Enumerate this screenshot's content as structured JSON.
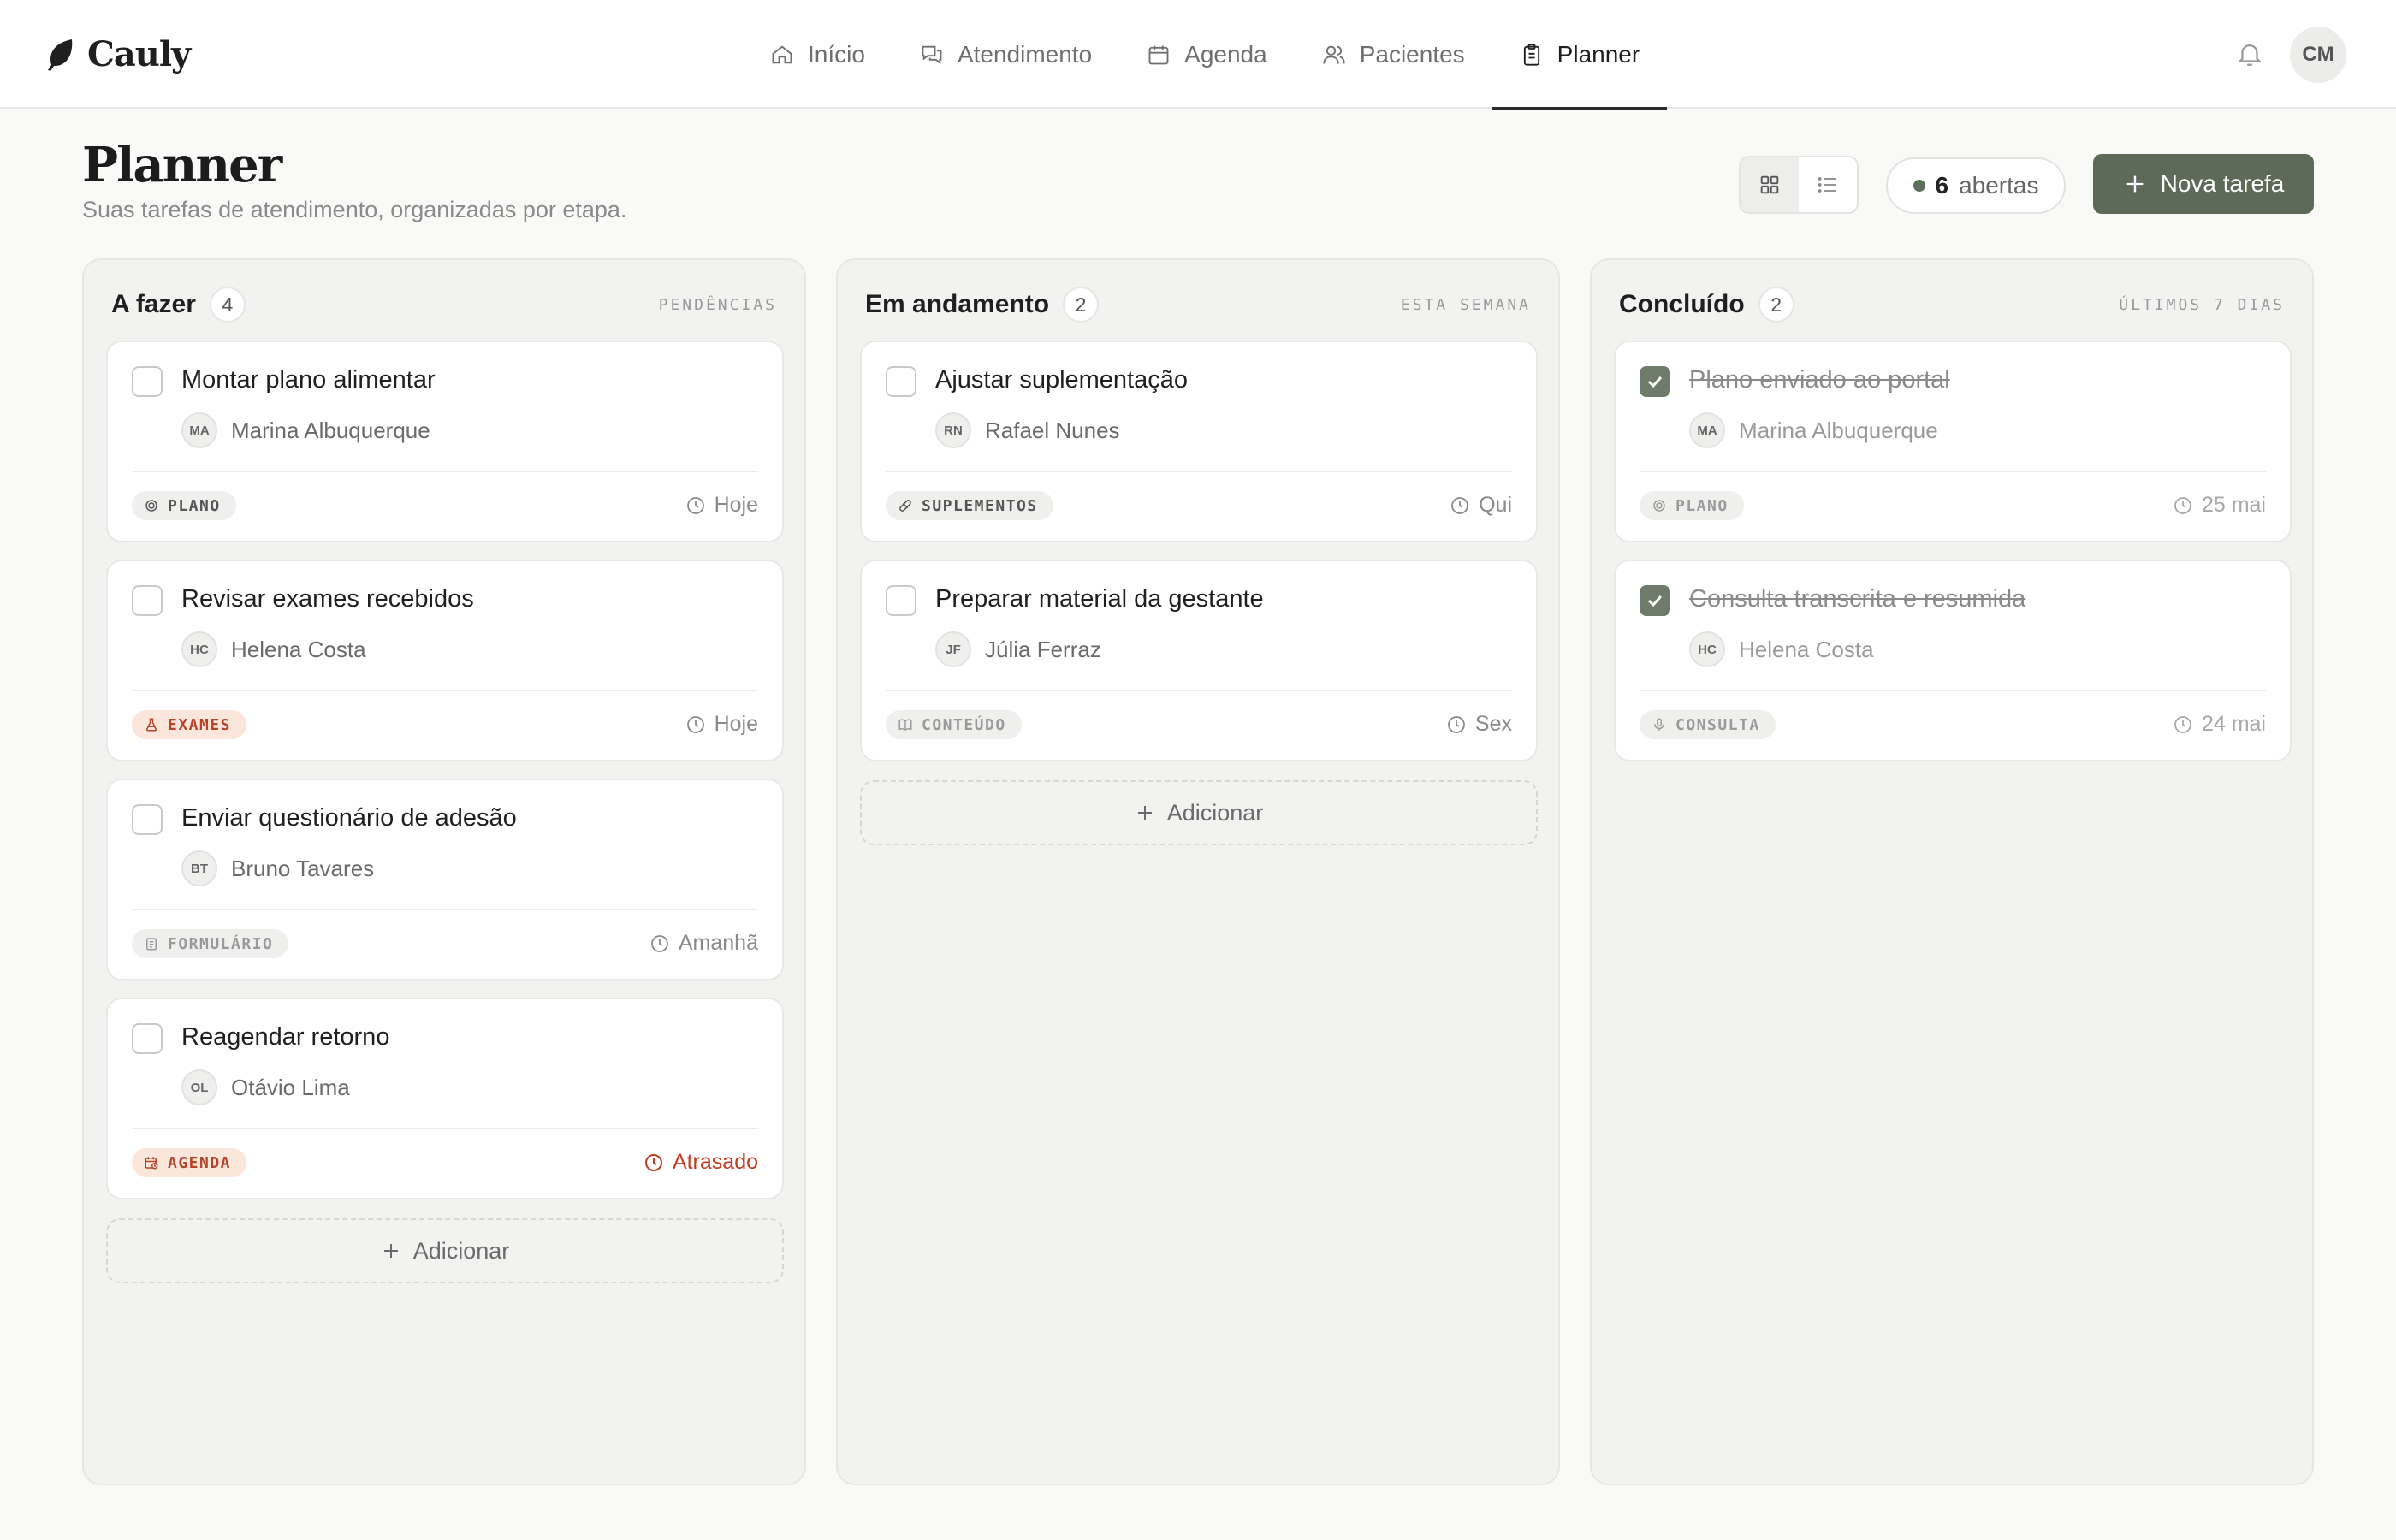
{
  "app": {
    "brand": "Cauly"
  },
  "nav": [
    {
      "label": "Início",
      "icon": "home-icon",
      "active": false
    },
    {
      "label": "Atendimento",
      "icon": "chat-icon",
      "active": false
    },
    {
      "label": "Agenda",
      "icon": "calendar-icon",
      "active": false
    },
    {
      "label": "Pacientes",
      "icon": "users-icon",
      "active": false
    },
    {
      "label": "Planner",
      "icon": "clipboard-icon",
      "active": true
    }
  ],
  "user": {
    "initials": "CM"
  },
  "header": {
    "title": "Planner",
    "subtitle": "Suas tarefas de atendimento, organizadas por etapa.",
    "open_count": "6",
    "open_label": "abertas",
    "new_task_label": "Nova tarefa",
    "view": "grid"
  },
  "columns": [
    {
      "title": "A fazer",
      "count": "4",
      "meta": "PENDÊNCIAS",
      "add_label": "Adicionar",
      "cards": [
        {
          "title": "Montar plano alimentar",
          "initials": "MA",
          "person": "Marina Albuquerque",
          "tag": "PLANO",
          "tag_icon": "plate-icon",
          "due": "Hoje",
          "done": false
        },
        {
          "title": "Revisar exames recebidos",
          "initials": "HC",
          "person": "Helena Costa",
          "tag": "EXAMES",
          "tag_icon": "flask-icon",
          "due": "Hoje",
          "done": false
        },
        {
          "title": "Enviar questionário de adesão",
          "initials": "BT",
          "person": "Bruno Tavares",
          "tag": "FORMULÁRIO",
          "tag_icon": "form-icon",
          "due": "Amanhã",
          "done": false
        },
        {
          "title": "Reagendar retorno",
          "initials": "OL",
          "person": "Otávio Lima",
          "tag": "AGENDA",
          "tag_icon": "calendar-clock-icon",
          "due": "Atrasado",
          "done": false
        }
      ]
    },
    {
      "title": "Em andamento",
      "count": "2",
      "meta": "ESTA SEMANA",
      "add_label": "Adicionar",
      "cards": [
        {
          "title": "Ajustar suplementação",
          "initials": "RN",
          "person": "Rafael Nunes",
          "tag": "SUPLEMENTOS",
          "tag_icon": "pill-icon",
          "due": "Qui",
          "done": false
        },
        {
          "title": "Preparar material da gestante",
          "initials": "JF",
          "person": "Júlia Ferraz",
          "tag": "CONTEÚDO",
          "tag_icon": "book-icon",
          "due": "Sex",
          "done": false
        }
      ]
    },
    {
      "title": "Concluído",
      "count": "2",
      "meta": "ÚLTIMOS 7 DIAS",
      "cards": [
        {
          "title": "Plano enviado ao portal",
          "initials": "MA",
          "person": "Marina Albuquerque",
          "tag": "PLANO",
          "tag_icon": "plate-icon",
          "due": "25 mai",
          "done": true
        },
        {
          "title": "Consulta transcrita e resumida",
          "initials": "HC",
          "person": "Helena Costa",
          "tag": "CONSULTA",
          "tag_icon": "mic-icon",
          "due": "24 mai",
          "done": true
        }
      ]
    }
  ],
  "colors": {
    "accent": "#5d6a58",
    "late": "#c13b1f",
    "warn_bg": "#fbe6dc"
  }
}
